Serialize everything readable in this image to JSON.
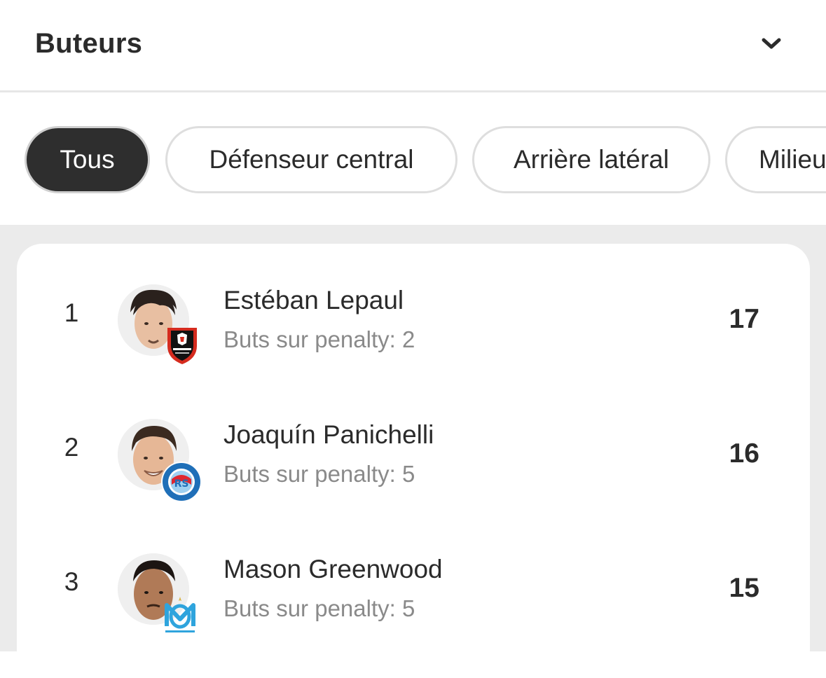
{
  "header": {
    "title": "Buteurs",
    "toggle_icon": "chevron-down-icon"
  },
  "filters": [
    {
      "label": "Tous",
      "active": true
    },
    {
      "label": "Défenseur central",
      "active": false
    },
    {
      "label": "Arrière latéral",
      "active": false
    },
    {
      "label": "Milieu",
      "active": false
    }
  ],
  "scorers": [
    {
      "rank": "1",
      "name": "Estéban Lepaul",
      "penalty": "Buts sur penalty: 2",
      "goals": "17",
      "club_badge": "stade-rennais-badge-icon"
    },
    {
      "rank": "2",
      "name": "Joaquín Panichelli",
      "penalty": "Buts sur penalty: 5",
      "goals": "16",
      "club_badge": "rc-strasbourg-badge-icon"
    },
    {
      "rank": "3",
      "name": "Mason Greenwood",
      "penalty": "Buts sur penalty: 5",
      "goals": "15",
      "club_badge": "olympique-marseille-badge-icon"
    }
  ],
  "colors": {
    "active_chip": "#2e2e2e",
    "list_background": "#ebebeb",
    "muted_text": "#8a8a8a"
  }
}
